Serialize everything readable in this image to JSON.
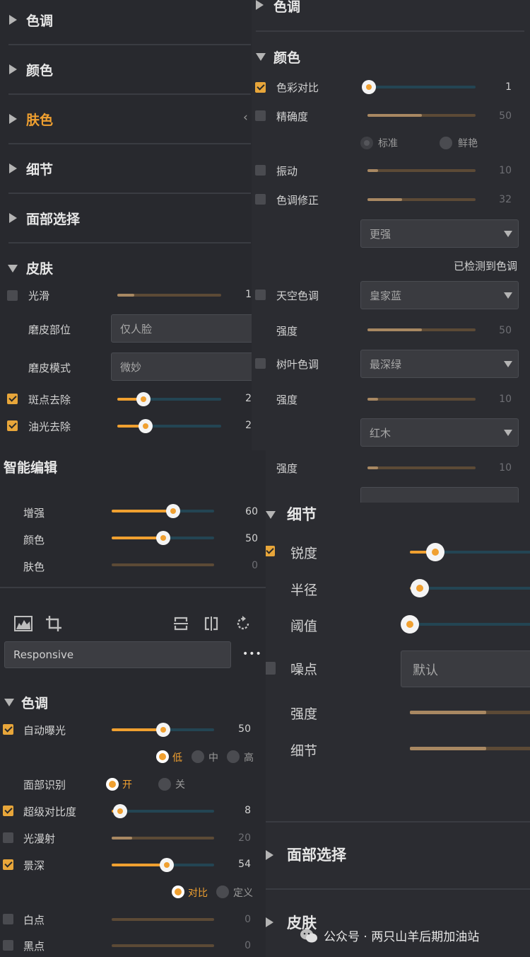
{
  "panelA": {
    "sections": [
      {
        "label": "色调"
      },
      {
        "label": "颜色"
      },
      {
        "label": "肤色"
      },
      {
        "label": "细节"
      },
      {
        "label": "面部选择"
      },
      {
        "label": "皮肤"
      }
    ],
    "skin": {
      "smooth": {
        "label": "光滑",
        "value": "1",
        "level": 16,
        "checked": false
      },
      "area": {
        "label": "磨皮部位",
        "value": "仅人脸"
      },
      "mode": {
        "label": "磨皮模式",
        "value": "微妙"
      },
      "spot": {
        "label": "斑点去除",
        "value": "2",
        "level": 25,
        "checked": true
      },
      "shine": {
        "label": "油光去除",
        "value": "2",
        "level": 27,
        "checked": true
      }
    }
  },
  "panelB": {
    "section_top": "色调",
    "section_color": "颜色",
    "contrast": {
      "label": "色彩对比",
      "value": "1",
      "level": 1,
      "checked": true
    },
    "precision": {
      "label": "精确度",
      "value": "50",
      "level": 50
    },
    "radio_standard": "标准",
    "radio_vivid": "鲜艳",
    "vibrance": {
      "label": "振动",
      "value": "10",
      "level": 10
    },
    "tone_fix": {
      "label": "色调修正",
      "value": "32",
      "level": 32
    },
    "tone_fix_select": "更强",
    "detected": "已检测到色调",
    "sky": {
      "label": "天空色调",
      "select": "皇家蓝"
    },
    "sky_strength": {
      "label": "强度",
      "value": "50",
      "level": 50
    },
    "foliage": {
      "label": "树叶色调",
      "select": "最深绿"
    },
    "foliage_strength": {
      "label": "强度",
      "value": "10",
      "level": 10
    },
    "wood_select": "红木",
    "wood_strength": {
      "label": "强度",
      "value": "10",
      "level": 10
    }
  },
  "panelC": {
    "smart_title": "智能编辑",
    "enhance": {
      "label": "增强",
      "value": "60",
      "level": 60
    },
    "color": {
      "label": "颜色",
      "value": "50",
      "level": 50
    },
    "skin": {
      "label": "肤色",
      "value": "0",
      "level": 0
    },
    "preset": "Responsive",
    "more": "•••",
    "tone_title": "色调",
    "auto_exposure": {
      "label": "自动曝光",
      "value": "50",
      "level": 50,
      "checked": true
    },
    "exposure_modes": [
      "低",
      "中",
      "高"
    ],
    "face_detect": {
      "label": "面部识别",
      "on": "开",
      "off": "关"
    },
    "super_contrast": {
      "label": "超级对比度",
      "value": "8",
      "level": 8,
      "checked": true
    },
    "diffuse": {
      "label": "光漫射",
      "value": "20",
      "level": 20,
      "checked": false
    },
    "depth": {
      "label": "景深",
      "value": "54",
      "level": 54,
      "checked": true
    },
    "depth_modes": [
      "对比",
      "定义"
    ],
    "white": {
      "label": "白点",
      "value": "0",
      "level": 0,
      "checked": false
    },
    "black": {
      "label": "黑点",
      "value": "0",
      "level": 0,
      "checked": false
    }
  },
  "panelD": {
    "detail_title": "细节",
    "sharpness": {
      "label": "锐度",
      "checked": true,
      "level": 20
    },
    "radius": {
      "label": "半径",
      "level": 8
    },
    "threshold": {
      "label": "阈值",
      "level": 0
    },
    "noise": {
      "label": "噪点",
      "select": "默认",
      "checked": false
    },
    "strength": {
      "label": "强度",
      "level": 60
    },
    "detail": {
      "label": "细节",
      "level": 60
    },
    "face_title": "面部选择",
    "skin_title": "皮肤"
  },
  "watermark": "公众号 · 两只山羊后期加油站",
  "colors": {
    "accent": "#f0a030",
    "panel": "#28292e",
    "track": "#234553"
  }
}
